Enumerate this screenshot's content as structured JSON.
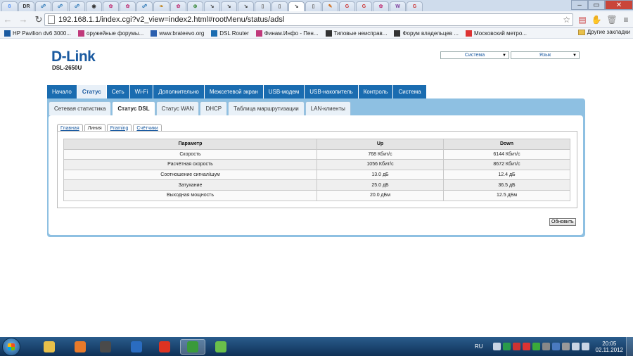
{
  "browser": {
    "url": "192.168.1.1/index.cgi?v2_view=index2.html#rootMenu/status/adsl",
    "tabs": [
      {
        "icon": "google-g-icon",
        "glyph": "8",
        "color": "#4a8af4"
      },
      {
        "icon": "dr-icon",
        "glyph": "DR",
        "color": "#333"
      },
      {
        "icon": "network-icon",
        "glyph": "☍",
        "color": "#1a6cb0"
      },
      {
        "icon": "network-icon",
        "glyph": "☍",
        "color": "#1a6cb0"
      },
      {
        "icon": "network-icon",
        "glyph": "☍",
        "color": "#1a6cb0"
      },
      {
        "icon": "power-icon",
        "glyph": "◉",
        "color": "#333"
      },
      {
        "icon": "gear-pink-icon",
        "glyph": "✿",
        "color": "#c0397b"
      },
      {
        "icon": "gear-pink-icon",
        "glyph": "✿",
        "color": "#c0397b"
      },
      {
        "icon": "network-icon",
        "glyph": "☍",
        "color": "#1a6cb0"
      },
      {
        "icon": "leaf-icon",
        "glyph": "❧",
        "color": "#c08a2c"
      },
      {
        "icon": "gear-pink-icon",
        "glyph": "✿",
        "color": "#c0397b"
      },
      {
        "icon": "globe-icon",
        "glyph": "⊕",
        "color": "#3a8a3a"
      },
      {
        "icon": "arrow-icon",
        "glyph": "↘",
        "color": "#333"
      },
      {
        "icon": "arrow-icon",
        "glyph": "↘",
        "color": "#333"
      },
      {
        "icon": "arrow-icon",
        "glyph": "↘",
        "color": "#333"
      },
      {
        "icon": "document-icon",
        "glyph": "▯",
        "color": "#666"
      },
      {
        "icon": "document-icon",
        "glyph": "▯",
        "color": "#666"
      },
      {
        "icon": "arrow-icon",
        "glyph": "↘",
        "color": "#333"
      },
      {
        "icon": "document-icon",
        "glyph": "▯",
        "color": "#666"
      },
      {
        "icon": "pencil-icon",
        "glyph": "✎",
        "color": "#d07020"
      },
      {
        "icon": "google-g-icon",
        "glyph": "G",
        "color": "#c33"
      },
      {
        "icon": "google-g-icon",
        "glyph": "G",
        "color": "#c33"
      },
      {
        "icon": "gear-pink-icon",
        "glyph": "✿",
        "color": "#c0397b"
      },
      {
        "icon": "wikipedia-icon",
        "glyph": "W",
        "color": "#7a3a9a"
      },
      {
        "icon": "google-g-icon",
        "glyph": "G",
        "color": "#c33"
      }
    ],
    "bookmarks": [
      {
        "label": "HP Pavilion dv6 3000...",
        "icon": "hp-icon",
        "color": "#1a5aa0"
      },
      {
        "label": "оружейные форумы...",
        "icon": "gear-pink-icon",
        "color": "#c0397b"
      },
      {
        "label": "www.brateevo.org",
        "icon": "site-icon",
        "color": "#2a5fae"
      },
      {
        "label": "DSL Router",
        "icon": "network-icon",
        "color": "#1a6cb0"
      },
      {
        "label": "Финам.Инфо - Пен...",
        "icon": "gear-pink-icon",
        "color": "#c0397b"
      },
      {
        "label": "Типовые неисправ...",
        "icon": "pin-icon",
        "color": "#333"
      },
      {
        "label": "Форум владельцев ...",
        "icon": "pin-icon",
        "color": "#333"
      },
      {
        "label": "Московский метро...",
        "icon": "yandex-icon",
        "color": "#d33"
      }
    ],
    "other_bookmarks": "Другие закладки"
  },
  "router": {
    "brand": "D-Link",
    "model": "DSL-2650U",
    "selects": {
      "system": "Система",
      "language": "Язык"
    },
    "menu": [
      "Начало",
      "Статус",
      "Сеть",
      "Wi-Fi",
      "Дополнительно",
      "Межсетевой экран",
      "USB-модем",
      "USB-накопитель",
      "Контроль",
      "Система"
    ],
    "subtabs": [
      "Сетевая статистика",
      "Статус DSL",
      "Статус WAN",
      "DHCP",
      "Таблица маршрутизации",
      "LAN-клиенты"
    ],
    "innertabs": [
      "Главная",
      "Линия",
      "Framing",
      "Счётчики"
    ],
    "table": {
      "headers": [
        "Параметр",
        "Up",
        "Down"
      ],
      "rows": [
        [
          "Скорость",
          "768 Кбит/с",
          "6144 Кбит/с"
        ],
        [
          "Расчётная скорость",
          "1056 Кбит/с",
          "8672 Кбит/с"
        ],
        [
          "Соотношение сигнал/шум",
          "13.0 дБ",
          "12.4 дБ"
        ],
        [
          "Затухание",
          "25.0 дБ",
          "36.5 дБ"
        ],
        [
          "Выходная мощность",
          "20.0 дБм",
          "12.5 дБм"
        ]
      ]
    },
    "refresh_button": "Обновить"
  },
  "taskbar": {
    "apps": [
      {
        "name": "file-explorer-icon",
        "color": "#e8c04a"
      },
      {
        "name": "media-player-icon",
        "color": "#e87a2a"
      },
      {
        "name": "hp-icon",
        "color": "#4a4a4a"
      },
      {
        "name": "mail-check-icon",
        "color": "#2a6cc0"
      },
      {
        "name": "opera-icon",
        "color": "#d32"
      },
      {
        "name": "chrome-icon",
        "color": "#3a9a3a"
      },
      {
        "name": "battery-app-icon",
        "color": "#6abf4a"
      }
    ],
    "language": "RU",
    "time": "20:05",
    "date": "02.11.2012",
    "tray": [
      {
        "name": "tray-up-icon",
        "color": "#c8d4e4"
      },
      {
        "name": "tray-green-icon",
        "color": "#2a9a4a"
      },
      {
        "name": "tray-shield-icon",
        "color": "#c33"
      },
      {
        "name": "tray-circle-icon",
        "color": "#d33"
      },
      {
        "name": "tray-green-icon",
        "color": "#3aaa3a"
      },
      {
        "name": "tray-gray-icon",
        "color": "#888"
      },
      {
        "name": "tray-blue-icon",
        "color": "#4a7ac0"
      },
      {
        "name": "tray-gray-icon",
        "color": "#999"
      },
      {
        "name": "network-tray-icon",
        "color": "#c8d4e4"
      },
      {
        "name": "volume-icon",
        "color": "#c8d4e4"
      }
    ]
  }
}
